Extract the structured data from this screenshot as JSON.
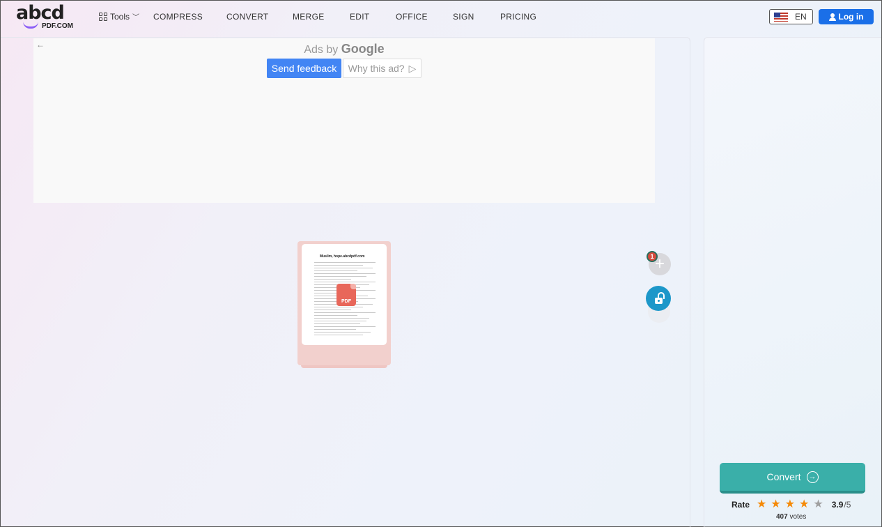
{
  "header": {
    "logo_text": "abcd",
    "logo_sub": "PDF.COM",
    "tools_label": "Tools",
    "nav": [
      "COMPRESS",
      "CONVERT",
      "MERGE",
      "EDIT",
      "OFFICE",
      "SIGN",
      "PRICING"
    ],
    "language": "EN",
    "login_label": "Log in"
  },
  "ad": {
    "back_arrow": "←",
    "ads_by": "Ads by",
    "google": "Google",
    "send_feedback": "Send feedback",
    "why_this_ad": "Why this ad?",
    "why_icon": "▷"
  },
  "file": {
    "page_title": "Muslim, hope.abcdpdf.com",
    "badge": "PDF",
    "count": "1"
  },
  "actions": {
    "add_symbol": "+"
  },
  "sidebar": {
    "convert_label": "Convert",
    "convert_icon": "→",
    "rate_label": "Rate",
    "stars_filled": 4,
    "stars_total": 5,
    "score": "3.9",
    "score_total": "/5",
    "votes_count": "407",
    "votes_label": "votes"
  },
  "colors": {
    "accent": "#3aafa9",
    "login": "#1a6fe8",
    "star": "#f58a07",
    "star_empty": "#a0a0a0"
  }
}
